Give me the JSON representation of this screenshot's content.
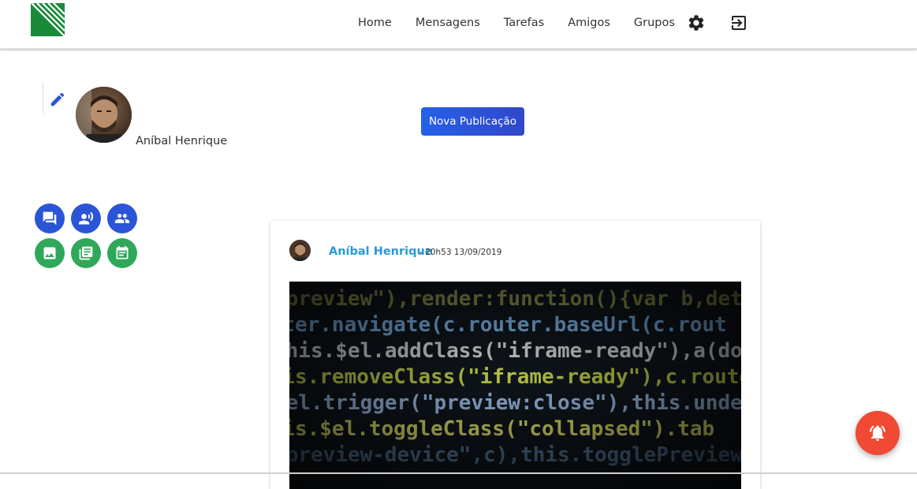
{
  "nav": {
    "links": [
      "Home",
      "Mensagens",
      "Tarefas",
      "Amigos",
      "Grupos"
    ],
    "icons": [
      "settings-icon",
      "logout-icon"
    ]
  },
  "profile": {
    "name": "Aníbal Henrique",
    "new_post_label": "Nova Publicação"
  },
  "quick_actions": [
    {
      "icon": "forum-icon",
      "color": "#2a55d6"
    },
    {
      "icon": "record-voice-icon",
      "color": "#2a55d6"
    },
    {
      "icon": "people-icon",
      "color": "#2a55d6"
    },
    {
      "icon": "image-icon",
      "color": "#2fa85a"
    },
    {
      "icon": "library-books-icon",
      "color": "#2fa85a"
    },
    {
      "icon": "event-note-icon",
      "color": "#2fa85a"
    }
  ],
  "post": {
    "author": "Aníbal Henrique",
    "meta": "- 20h53 13/09/2019",
    "image_code_lines": [
      "\"preview\"),render:function(){var b,det",
      "outer.navigate(c.router.baseUrl(c.rout",
      "this.$el.addClass(\"iframe-ready\"),a(docu",
      "this.removeClass(\"iframe-ready\"),c.route",
      "$el.trigger(\"preview:close\"),this.undele",
      "this.$el.toggleClass(\"collapsed\").tab",
      "\"preview-device\",c),this.togglePreviewDe"
    ]
  },
  "colors": {
    "brand_green": "#1a8a3a",
    "primary_blue": "#2a55d6",
    "accent_green": "#2fa85a",
    "author_link": "#2a9ad6",
    "fab_red": "#f04a35"
  },
  "fab": {
    "icon": "notification-bell-icon"
  }
}
